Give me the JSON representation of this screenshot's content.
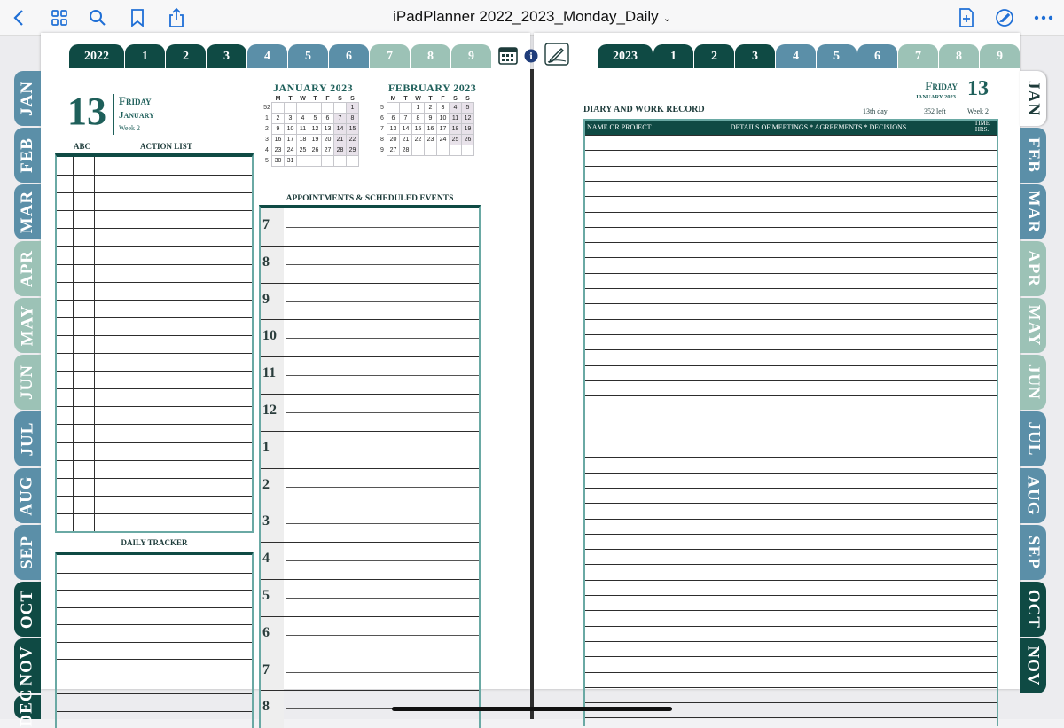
{
  "toolbar": {
    "title": "iPadPlanner 2022_2023_Monday_Daily",
    "icons": [
      "back-chevron-icon",
      "grid-icon",
      "search-icon",
      "bookmark-icon",
      "share-icon",
      "add-page-icon",
      "markup-icon",
      "more-icon"
    ]
  },
  "center_icons": [
    "calendar-icon",
    "info-icon",
    "edit-icon"
  ],
  "left_year_tabs": [
    "2022",
    "1",
    "2",
    "3",
    "4",
    "5",
    "6",
    "7",
    "8",
    "9"
  ],
  "right_year_tabs": [
    "2023",
    "1",
    "2",
    "3",
    "4",
    "5",
    "6",
    "7",
    "8",
    "9"
  ],
  "left_month_tabs": [
    "JAN",
    "FEB",
    "MAR",
    "APR",
    "MAY",
    "JUN",
    "JUL",
    "AUG",
    "SEP",
    "OCT",
    "NOV",
    "DEC"
  ],
  "right_month_tabs": [
    "JAN",
    "FEB",
    "MAR",
    "APR",
    "MAY",
    "JUN",
    "JUL",
    "AUG",
    "SEP",
    "OCT",
    "NOV"
  ],
  "colors": {
    "dark_teal": "#0f4a44",
    "mid_teal": "#5b8fa8",
    "light_sage": "#9cc2b6",
    "frame": "#6aa9a4"
  },
  "left_page": {
    "date_number": "13",
    "weekday": "Friday",
    "month": "January",
    "week": "Week 2",
    "abc_label": "ABC",
    "action_list_label": "ACTION  LIST",
    "daily_tracker_label": "DAILY TRACKER",
    "appointments_label": "APPOINTMENTS & SCHEDULED EVENTS",
    "hours": [
      "7",
      "8",
      "9",
      "10",
      "11",
      "12",
      "1",
      "2",
      "3",
      "4",
      "5",
      "6",
      "7",
      "8"
    ]
  },
  "mini_calendars": [
    {
      "title": "JANUARY 2023",
      "dow": [
        "M",
        "T",
        "W",
        "T",
        "F",
        "S",
        "S"
      ],
      "weeks": [
        {
          "wk": "52",
          "days": [
            "",
            "",
            "",
            "",
            "",
            "",
            "1"
          ]
        },
        {
          "wk": "1",
          "days": [
            "2",
            "3",
            "4",
            "5",
            "6",
            "7",
            "8"
          ]
        },
        {
          "wk": "2",
          "days": [
            "9",
            "10",
            "11",
            "12",
            "13",
            "14",
            "15"
          ]
        },
        {
          "wk": "3",
          "days": [
            "16",
            "17",
            "18",
            "19",
            "20",
            "21",
            "22"
          ]
        },
        {
          "wk": "4",
          "days": [
            "23",
            "24",
            "25",
            "26",
            "27",
            "28",
            "29"
          ]
        },
        {
          "wk": "5",
          "days": [
            "30",
            "31",
            "",
            "",
            "",
            "",
            ""
          ]
        }
      ]
    },
    {
      "title": "FEBRUARY 2023",
      "dow": [
        "M",
        "T",
        "W",
        "T",
        "F",
        "S",
        "S"
      ],
      "weeks": [
        {
          "wk": "5",
          "days": [
            "",
            "",
            "1",
            "2",
            "3",
            "4",
            "5"
          ]
        },
        {
          "wk": "6",
          "days": [
            "6",
            "7",
            "8",
            "9",
            "10",
            "11",
            "12"
          ]
        },
        {
          "wk": "7",
          "days": [
            "13",
            "14",
            "15",
            "16",
            "17",
            "18",
            "19"
          ]
        },
        {
          "wk": "8",
          "days": [
            "20",
            "21",
            "22",
            "23",
            "24",
            "25",
            "26"
          ]
        },
        {
          "wk": "9",
          "days": [
            "27",
            "28",
            "",
            "",
            "",
            "",
            ""
          ]
        }
      ]
    }
  ],
  "right_page": {
    "weekday": "Friday",
    "date_number": "13",
    "month_year": "JANUARY 2023",
    "day_of_year": "13th day",
    "days_left": "352 left",
    "week": "Week 2",
    "diary_label": "DIARY AND WORK RECORD",
    "col_name": "NAME OR PROJECT",
    "col_details": "DETAILS OF MEETINGS * AGREEMENTS * DECISIONS",
    "col_time": "TIME HRS."
  }
}
